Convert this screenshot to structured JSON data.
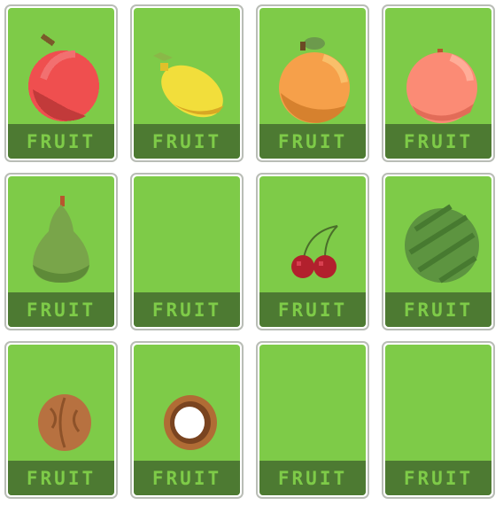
{
  "cards": [
    {
      "label": "FRUIT",
      "icon": "apple-icon"
    },
    {
      "label": "FRUIT",
      "icon": "lemon-icon"
    },
    {
      "label": "FRUIT",
      "icon": "orange-icon"
    },
    {
      "label": "FRUIT",
      "icon": "peach-icon"
    },
    {
      "label": "FRUIT",
      "icon": "pear-icon"
    },
    {
      "label": "FRUIT",
      "icon": ""
    },
    {
      "label": "FRUIT",
      "icon": "cherries-icon"
    },
    {
      "label": "FRUIT",
      "icon": "watermelon-icon"
    },
    {
      "label": "FRUIT",
      "icon": "walnut-icon"
    },
    {
      "label": "FRUIT",
      "icon": "coconut-icon"
    },
    {
      "label": "FRUIT",
      "icon": ""
    },
    {
      "label": "FRUIT",
      "icon": ""
    }
  ],
  "colors": {
    "card_green": "#7ecb48",
    "label_bar": "#4d7a32",
    "border": "#b9bdb6"
  }
}
